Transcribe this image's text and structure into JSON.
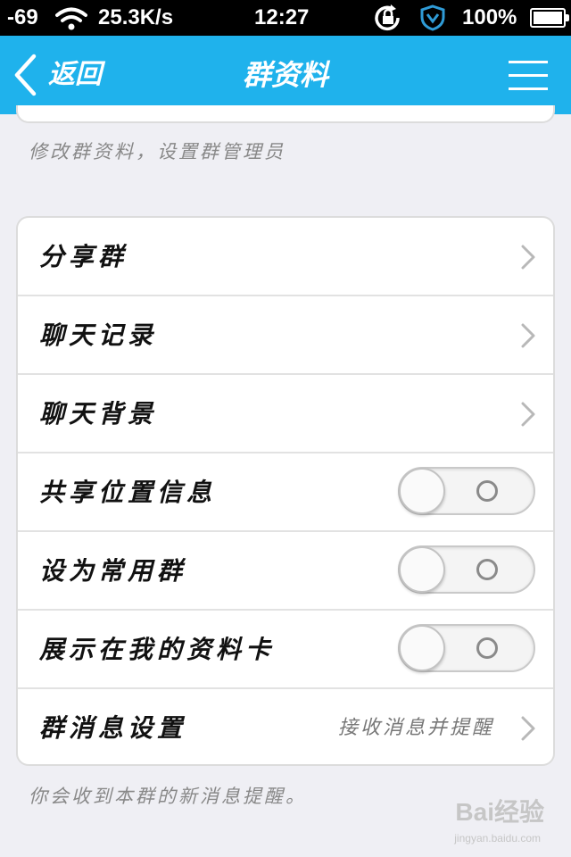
{
  "status_bar": {
    "signal": "-69",
    "speed": "25.3K/s",
    "time": "12:27",
    "battery": "100%"
  },
  "nav": {
    "back_label": "返回",
    "title": "群资料",
    "accent_color": "#1fb2ec"
  },
  "notes": {
    "top": "修改群资料，设置群管理员",
    "bottom": "你会收到本群的新消息提醒。"
  },
  "settings": {
    "share_group": "分享群",
    "chat_history": "聊天记录",
    "chat_background": "聊天背景",
    "share_location": {
      "label": "共享位置信息",
      "on": false
    },
    "set_frequent": {
      "label": "设为常用群",
      "on": false
    },
    "show_on_card": {
      "label": "展示在我的资料卡",
      "on": false
    },
    "message_settings": {
      "label": "群消息设置",
      "value": "接收消息并提醒"
    }
  },
  "watermark": {
    "brand": "Bai经验",
    "url": "jingyan.baidu.com"
  }
}
